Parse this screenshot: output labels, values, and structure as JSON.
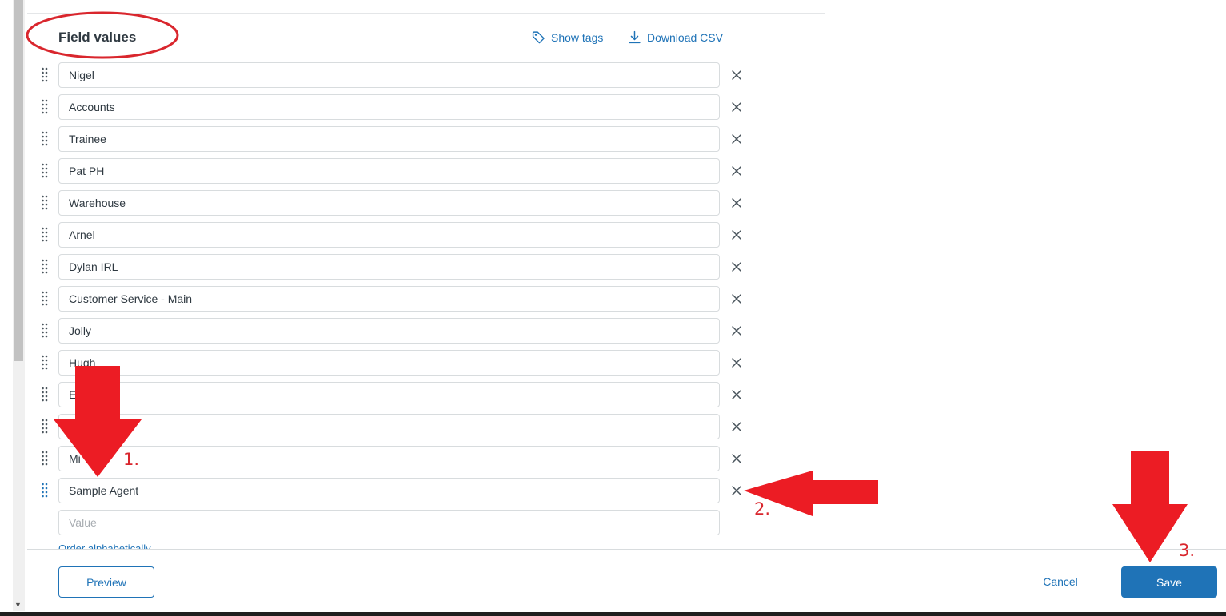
{
  "section": {
    "title": "Field values",
    "show_tags_label": "Show tags",
    "download_csv_label": "Download CSV"
  },
  "values": [
    "Nigel",
    "Accounts",
    "Trainee",
    "Pat PH",
    "Warehouse",
    "Arnel",
    "Dylan IRL",
    "Customer Service - Main",
    "Jolly",
    "Hugh",
    "E",
    "",
    "Mi",
    "Sample Agent"
  ],
  "new_value": {
    "value": "",
    "placeholder": "Value"
  },
  "order_alphabetically_label": "Order alphabetically",
  "footer": {
    "preview_label": "Preview",
    "cancel_label": "Cancel",
    "save_label": "Save"
  },
  "annotations": {
    "step1_label": "1.",
    "step2_label": "2.",
    "step3_label": "3.",
    "color": "#ec1c24"
  },
  "colors": {
    "accent": "#1f73b7",
    "text": "#2f3941",
    "border": "#d8dcde"
  }
}
